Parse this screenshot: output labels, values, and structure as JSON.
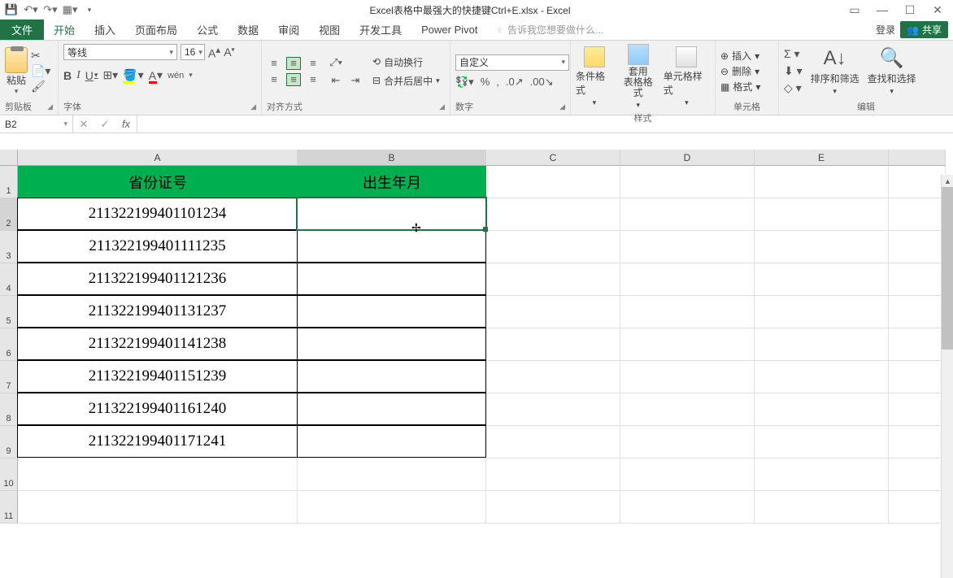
{
  "title": "Excel表格中最强大的快捷键Ctrl+E.xlsx - Excel",
  "qat": {
    "save": "save-icon",
    "undo": "undo-icon",
    "redo": "redo-icon",
    "new": "new-icon"
  },
  "tabs": {
    "file": "文件",
    "items": [
      "开始",
      "插入",
      "页面布局",
      "公式",
      "数据",
      "审阅",
      "视图",
      "开发工具",
      "Power Pivot"
    ],
    "active_index": 0,
    "tell_me": "告诉我您想要做什么...",
    "login": "登录",
    "share": "共享"
  },
  "ribbon": {
    "clipboard": {
      "paste": "粘贴",
      "label": "剪贴板"
    },
    "font": {
      "name": "等线",
      "size": "16",
      "bold": "B",
      "italic": "I",
      "underline": "U",
      "wen": "wén",
      "label": "字体"
    },
    "alignment": {
      "wrap": "自动换行",
      "merge": "合并后居中",
      "label": "对齐方式"
    },
    "number": {
      "format": "自定义",
      "label": "数字"
    },
    "styles": {
      "cond": "条件格式",
      "table": "套用\n表格格式",
      "cell": "单元格样式",
      "label": "样式"
    },
    "cells": {
      "insert": "插入",
      "delete": "删除",
      "format": "格式",
      "label": "单元格"
    },
    "editing": {
      "sort": "排序和筛选",
      "find": "查找和选择",
      "label": "编辑"
    }
  },
  "formula_bar": {
    "name_box": "B2",
    "fx": "fx",
    "value": ""
  },
  "grid": {
    "columns": [
      "A",
      "B",
      "C",
      "D",
      "E",
      ""
    ],
    "rows": [
      {
        "n": "1",
        "a": "省份证号",
        "b": "出生年月",
        "type": "header"
      },
      {
        "n": "2",
        "a": "211322199401101234",
        "b": ""
      },
      {
        "n": "3",
        "a": "211322199401111235",
        "b": ""
      },
      {
        "n": "4",
        "a": "211322199401121236",
        "b": ""
      },
      {
        "n": "5",
        "a": "211322199401131237",
        "b": ""
      },
      {
        "n": "6",
        "a": "211322199401141238",
        "b": ""
      },
      {
        "n": "7",
        "a": "211322199401151239",
        "b": ""
      },
      {
        "n": "8",
        "a": "211322199401161240",
        "b": ""
      },
      {
        "n": "9",
        "a": "211322199401171241",
        "b": ""
      },
      {
        "n": "10",
        "a": "",
        "b": "",
        "type": "blank"
      },
      {
        "n": "11",
        "a": "",
        "b": "",
        "type": "blank"
      }
    ],
    "active_cell": "B2"
  }
}
